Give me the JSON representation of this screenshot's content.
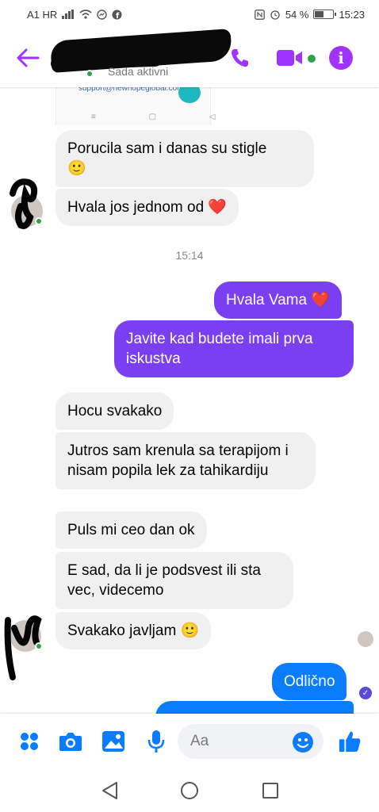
{
  "status_bar": {
    "carrier": "A1 HR",
    "battery": "54 %",
    "battery_level": 0.54,
    "time": "15:23"
  },
  "header": {
    "status": "Sada aktivni",
    "icons": [
      "back-arrow-icon",
      "phone-icon",
      "video-camera-icon",
      "info-icon"
    ],
    "accent_color": "#a033ff"
  },
  "shared_image": {
    "email": "support@newhopeglobal.com",
    "nav_glyphs": "≡ ▢ ◁"
  },
  "messages": {
    "m1": "Porucila sam i danas su stigle",
    "m1_emoji": "🙂",
    "m2": "Hvala jos jednom od ❤️",
    "timestamp": "15:14",
    "m3": "Hvala Vama ❤️",
    "m4": "Javite kad budete imali prva iskustva",
    "m5": "Hocu svakako",
    "m6": "Jutros sam krenula sa terapijom i nisam popila lek za tahikardiju",
    "m7": "Puls mi ceo dan ok",
    "m8": "E sad, da li je podsvest ili sta vec, videcemo",
    "m9": "Svakako javljam 🙂",
    "m10": "Odlično"
  },
  "composer": {
    "placeholder": "Aa",
    "icons": [
      "menu-dots-icon",
      "camera-icon",
      "gallery-icon",
      "microphone-icon",
      "emoji-icon",
      "thumbs-up-icon"
    ],
    "accent_color": "#0a7cff"
  },
  "colors": {
    "outgoing_purple": "#7b3ff2",
    "outgoing_blue": "#0a7cff",
    "incoming_gray": "#f0f0f0",
    "online_green": "#31a24c"
  }
}
